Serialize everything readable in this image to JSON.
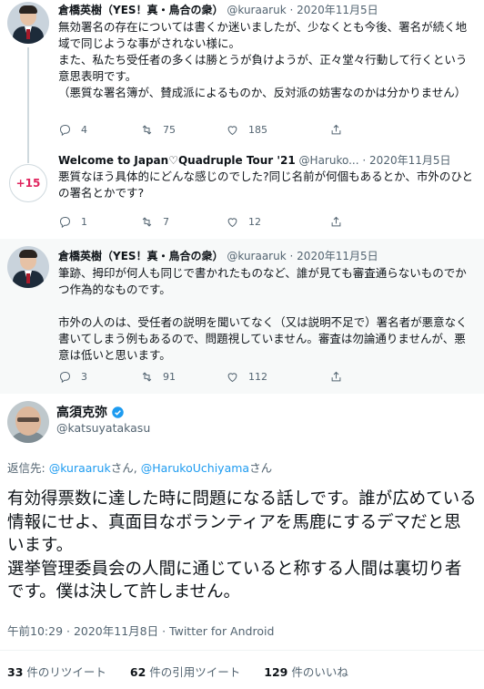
{
  "tweet1": {
    "name": "倉橋英樹（YES！真・鳥合の衆）",
    "handle": "@kuraaruk",
    "sep": "·",
    "date": "2020年11月5日",
    "body": "無効署名の存在については書くか迷いましたが、少なくとも今後、署名が続く地域で同じような事がされない様に。\nまた、私たち受任者の多くは勝とうが負けようが、正々堂々行動して行くという意思表明です。\n（悪質な署名簿が、賛成派によるものか、反対派の妨害なのかは分かりません）",
    "replies": "4",
    "retweets": "75",
    "likes": "185"
  },
  "tweet2": {
    "more_replies": "+15",
    "name": "Welcome to Japan♡Quadruple Tour '21",
    "handle": "@Haruko...",
    "sep": "·",
    "date": "2020年11月5日",
    "body": "悪質なほう具体的にどんな感じのでした?同じ名前が何個もあるとか、市外のひとの署名とかです?",
    "replies": "1",
    "retweets": "7",
    "likes": "12"
  },
  "tweet3": {
    "name": "倉橋英樹（YES！真・鳥合の衆）",
    "handle": "@kuraaruk",
    "sep": "·",
    "date": "2020年11月5日",
    "body": "筆跡、拇印が何人も同じで書かれたものなど、誰が見ても審査通らないものでかつ作為的なものです。\n\n市外の人のは、受任者の説明を聞いてなく（又は説明不足で）署名者が悪意なく書いてしまう例もあるので、問題視していません。審査は勿論通りませんが、悪意は低いと思います。",
    "replies": "3",
    "retweets": "91",
    "likes": "112"
  },
  "main": {
    "name": "高須克弥",
    "handle": "@katsuyatakasu",
    "reply_prefix": "返信先: ",
    "reply_user1": "@kuraaruk",
    "reply_mid": "さん, ",
    "reply_user2": "@HarukoUchiyama",
    "reply_suffix": "さん",
    "text": "有効得票数に達した時に問題になる話しです。誰が広めている情報にせよ、真面目なボランティアを馬鹿にするデマだと思います。\n選挙管理委員会の人間に通じていると称する人間は裏切り者です。僕は決して許しません。",
    "meta": "午前10:29 · 2020年11月8日 · Twitter for Android",
    "retweets_count": "33",
    "retweets_label": " 件のリツイート",
    "quotes_count": "62",
    "quotes_label": " 件の引用ツイート",
    "likes_count": "129",
    "likes_label": " 件のいいね"
  },
  "colors": {
    "link": "#1d9bf0",
    "secondary_text": "#536471",
    "verified": "#1d9bf0",
    "more_replies": "#e0245e"
  },
  "icons": [
    "avatar",
    "reply-icon",
    "retweet-icon",
    "like-icon",
    "share-icon",
    "verified-badge-icon"
  ]
}
